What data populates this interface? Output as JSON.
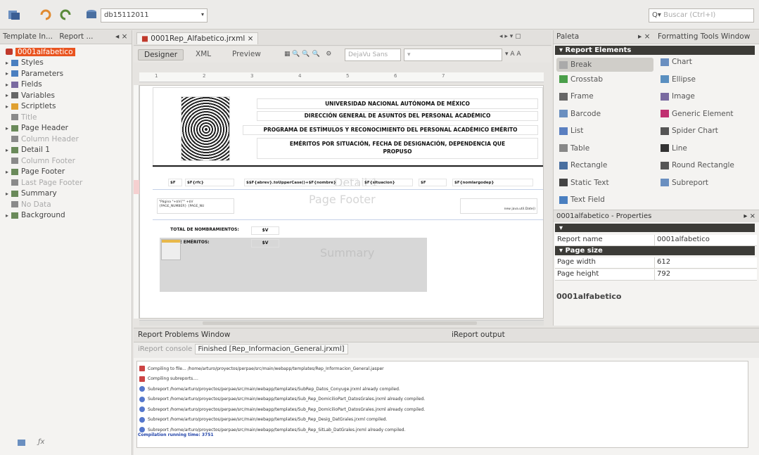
{
  "toolbar": {
    "combo_value": "db15112011",
    "search_placeholder": "Buscar (Ctrl+I)"
  },
  "left_panel": {
    "tabs": [
      "Template In...",
      "Report ..."
    ],
    "root": "0001alfabetico",
    "items": [
      {
        "label": "Styles",
        "dim": false
      },
      {
        "label": "Parameters",
        "dim": false
      },
      {
        "label": "Fields",
        "dim": false
      },
      {
        "label": "Variables",
        "dim": false
      },
      {
        "label": "Scriptlets",
        "dim": false
      },
      {
        "label": "Title",
        "dim": true
      },
      {
        "label": "Page Header",
        "dim": false
      },
      {
        "label": "Column Header",
        "dim": true
      },
      {
        "label": "Detail 1",
        "dim": false
      },
      {
        "label": "Column Footer",
        "dim": true
      },
      {
        "label": "Page Footer",
        "dim": false
      },
      {
        "label": "Last Page Footer",
        "dim": true
      },
      {
        "label": "Summary",
        "dim": false
      },
      {
        "label": "No Data",
        "dim": true
      },
      {
        "label": "Background",
        "dim": false
      }
    ]
  },
  "editor": {
    "doc_tab": "0001Rep_Alfabetico.jrxml",
    "modes": [
      "Designer",
      "XML",
      "Preview"
    ],
    "font_combo": "DejaVu Sans",
    "ruler_marks": [
      "1",
      "2",
      "3",
      "4",
      "5",
      "6",
      "7"
    ],
    "report": {
      "title1": "UNIVERSIDAD NACIONAL AUTÓNOMA DE MÉXICO",
      "title2": "DIRECCIÓN GENERAL DE ASUNTOS DEL PERSONAL ACADÉMICO",
      "title3": "PROGRAMA DE ESTÍMULOS Y RECONOCIMIENTO DEL PERSONAL ACADÉMICO EMÉRITO",
      "title4": "EMÉRITOS POR SITUACIÓN, FECHA DE DESIGNACIÓN, DEPENDENCIA QUE PROPUSO",
      "fields": [
        "$F",
        "$F{rfc}",
        "$$F{abrev}.toUpperCase()+$F{nombre}",
        "$F{situacion}",
        "$F",
        "$F{nomlargodep}"
      ],
      "footer_left": "\"Página \"+$V{\"\" +$V\n{PAGE_NUMBER} {PAGE_NU",
      "footer_right": "new java.util.Date()",
      "page_footer_label": "Page Footer",
      "detail_label": "Detail 1",
      "summary_label": "Summary",
      "total1_label": "TOTAL DE NOMBRAMIENTOS:",
      "total1_value": "$V",
      "total2_label": "AL DE EMÉRITOS:",
      "total2_value": "$V"
    }
  },
  "right_panel": {
    "tabs": [
      "Paleta",
      "Formatting Tools Window"
    ],
    "section": "Report Elements",
    "palette": [
      [
        "Break",
        "Chart"
      ],
      [
        "Crosstab",
        "Ellipse"
      ],
      [
        "Frame",
        "Image"
      ],
      [
        "Barcode",
        "Generic Element"
      ],
      [
        "List",
        "Spider Chart"
      ],
      [
        "Table",
        "Line"
      ],
      [
        "Rectangle",
        "Round Rectangle"
      ],
      [
        "Static Text",
        "Subreport"
      ],
      [
        "Text Field",
        ""
      ]
    ],
    "props_title": "0001alfabetico - Properties",
    "props": [
      {
        "k": "Report name",
        "v": "0001alfabetico"
      },
      {
        "k": "Page width",
        "v": "612"
      },
      {
        "k": "Page height",
        "v": "792"
      }
    ],
    "props_section": "Page size",
    "footer_name": "0001alfabetico"
  },
  "bottom": {
    "tab_left": "Report Problems Window",
    "tab_right": "iReport output",
    "subtabs": [
      "iReport console",
      "Finished [Rep_Informacion_General.jrxml]"
    ],
    "log": [
      {
        "w": true,
        "t": "Compiling to file... /home/arturo/proyectos/perpae/src/main/webapp/templates/Rep_Informacion_General.jasper"
      },
      {
        "w": true,
        "t": "Compiling subreports...."
      },
      {
        "w": false,
        "t": "Subreport /home/arturo/proyectos/perpae/src/main/webapp/templates/SubRep_Datos_Conyuge.jrxml already compiled."
      },
      {
        "w": false,
        "t": "Subreport /home/arturo/proyectos/perpae/src/main/webapp/templates/Sub_Rep_DomicilioPart_DatosGrales.jrxml already compiled."
      },
      {
        "w": false,
        "t": "Subreport /home/arturo/proyectos/perpae/src/main/webapp/templates/Sub_Rep_DomicilioPart_DatosGrales.jrxml already compiled."
      },
      {
        "w": false,
        "t": "Subreport /home/arturo/proyectos/perpae/src/main/webapp/templates/Sub_Rep_Desig_DatGrales.jrxml compiled."
      },
      {
        "w": false,
        "t": "Subreport /home/arturo/proyectos/perpae/src/main/webapp/templates/Sub_Rep_SitLab_DatGrales.jrxml already compiled."
      }
    ],
    "status": "Compilation running time: 3751"
  }
}
